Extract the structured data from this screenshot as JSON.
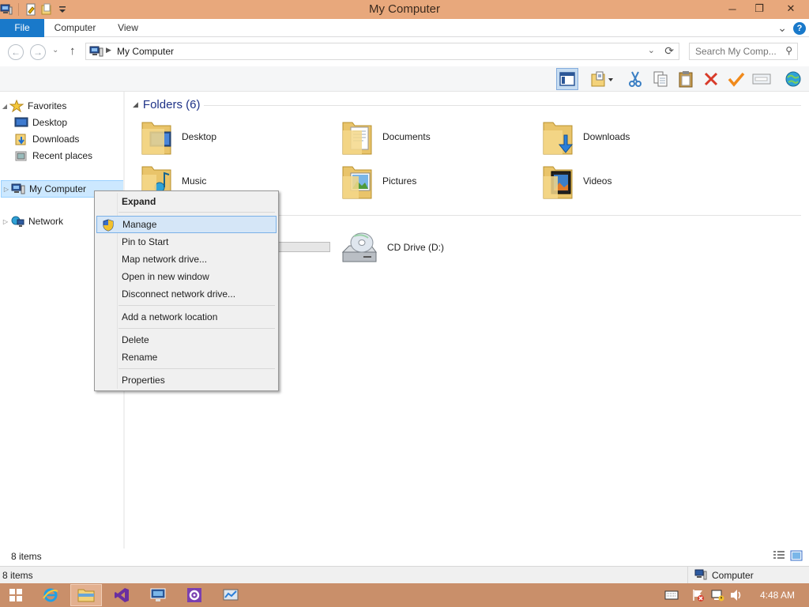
{
  "window": {
    "title": "My Computer",
    "minimize_glyph": "─",
    "maximize_glyph": "❐",
    "close_glyph": "✕"
  },
  "ribbon": {
    "tabs": [
      {
        "label": "File"
      },
      {
        "label": "Computer"
      },
      {
        "label": "View"
      }
    ],
    "help_glyph": "?",
    "expand_glyph": "⌄"
  },
  "nav": {
    "back_glyph": "←",
    "forward_glyph": "→",
    "recent_glyph": "⌄",
    "up_glyph": "↑"
  },
  "address": {
    "path": "My Computer",
    "crumb_arrow": "▶",
    "drop_glyph": "⌄",
    "refresh_glyph": "⟳"
  },
  "search": {
    "placeholder": "Search My Comp...",
    "icon_glyph": "⚲"
  },
  "sidebar": {
    "favorites_label": "Favorites",
    "favorites_items": [
      {
        "label": "Desktop"
      },
      {
        "label": "Downloads"
      },
      {
        "label": "Recent places"
      }
    ],
    "my_computer_label": "My Computer",
    "network_label": "Network",
    "expand_glyph": "▷"
  },
  "content": {
    "folders_header": "Folders (6)",
    "header_caret": "◢",
    "folders": [
      {
        "label": "Desktop",
        "overlay": "desktop"
      },
      {
        "label": "Documents",
        "overlay": "documents"
      },
      {
        "label": "Downloads",
        "overlay": "downloads"
      },
      {
        "label": "Music",
        "overlay": "music"
      },
      {
        "label": "Pictures",
        "overlay": "pictures"
      },
      {
        "label": "Videos",
        "overlay": "videos"
      }
    ],
    "devices": [
      {
        "label": "CD Drive (D:)"
      }
    ]
  },
  "context_menu": {
    "items": [
      {
        "label": "Expand",
        "bold": true
      },
      {
        "label": "Manage",
        "highlighted": true,
        "icon": "uac-shield-icon"
      },
      {
        "label": "Pin to Start"
      },
      {
        "label": "Map network drive..."
      },
      {
        "label": "Open in new window"
      },
      {
        "label": "Disconnect network drive..."
      },
      {
        "label": "Add a network location"
      },
      {
        "label": "Delete"
      },
      {
        "label": "Rename"
      },
      {
        "label": "Properties"
      }
    ]
  },
  "status": {
    "item_count": "8 items",
    "bottom_count": "8 items",
    "location_label": "Computer"
  },
  "taskbar": {
    "clock": "4:48 AM"
  },
  "colors": {
    "titlebar": "#e8a87c",
    "file_tab": "#1979ca",
    "taskbar": "#c98f6a",
    "selection": "#cce8ff",
    "menu_highlight": "#d5e6f7",
    "group_header_text": "#1e3287"
  }
}
